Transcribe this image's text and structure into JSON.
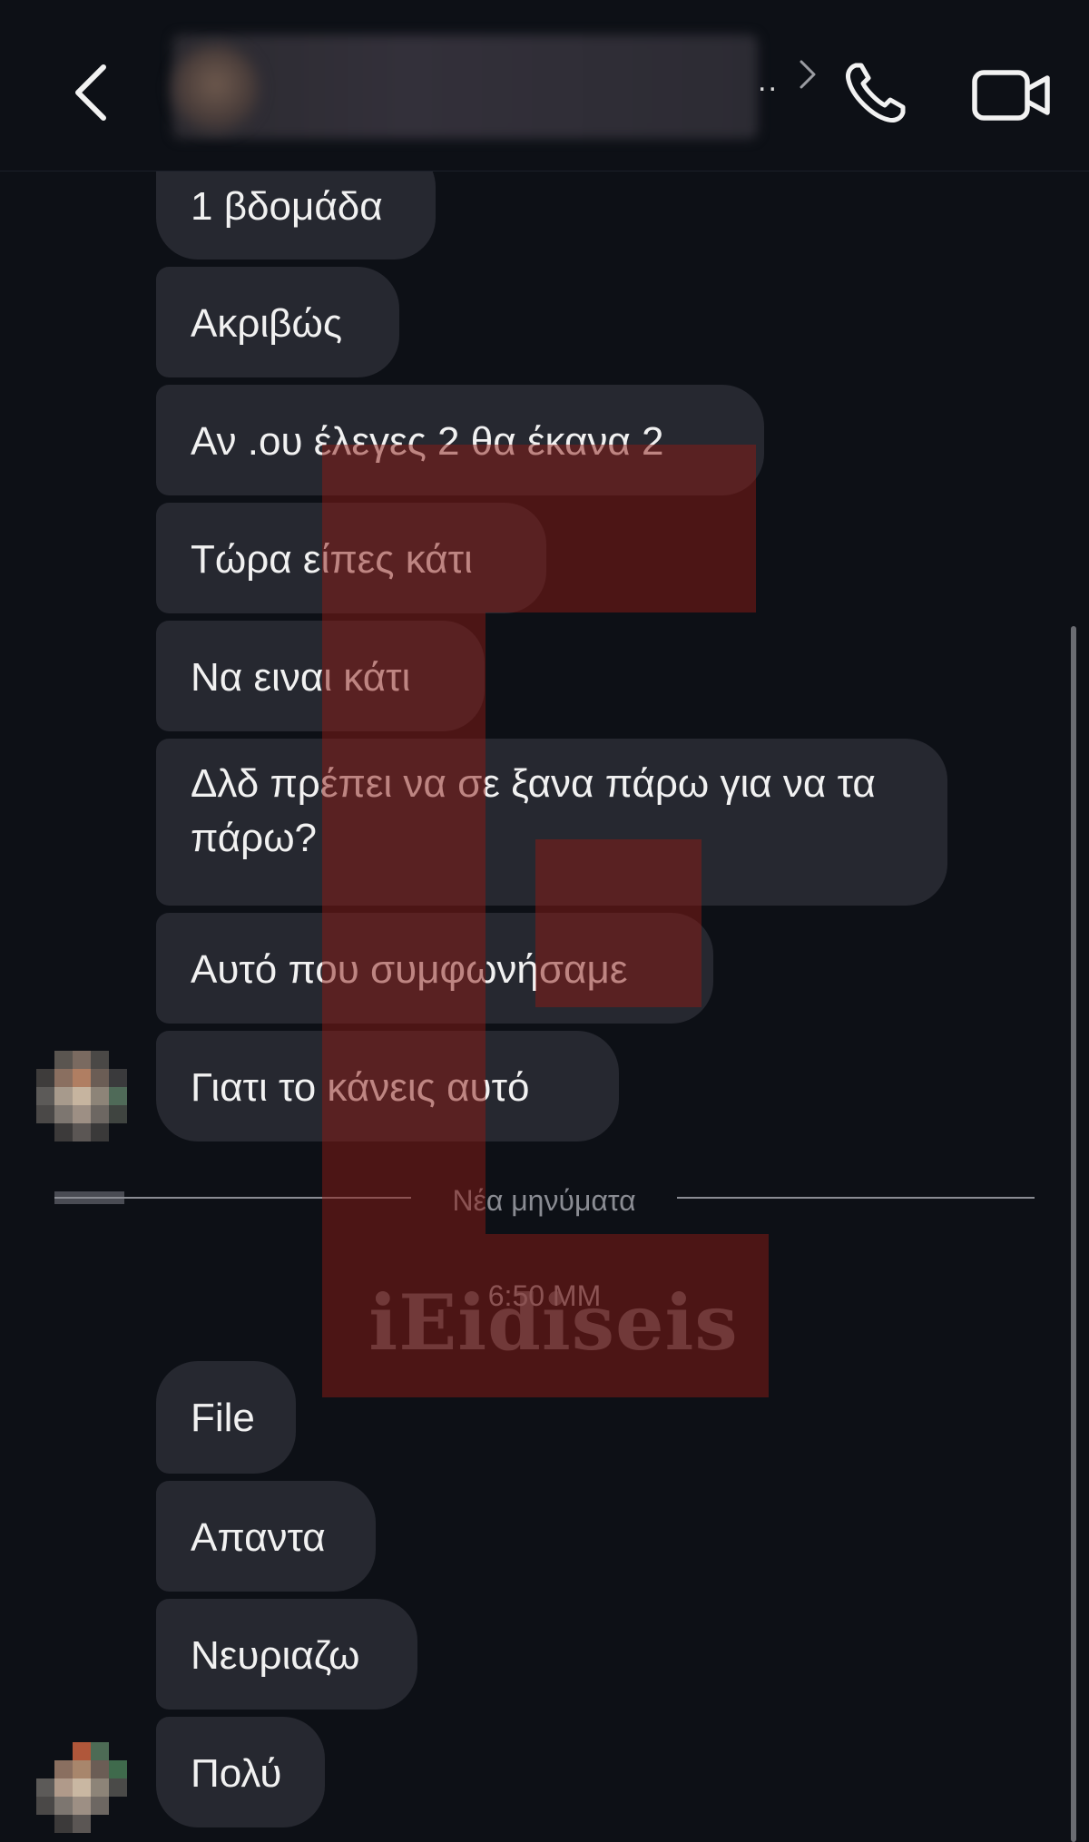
{
  "header": {
    "back_icon": "chevron-left-icon",
    "contact_name_visible_suffix": "..",
    "call_icon": "phone-icon",
    "video_icon": "video-camera-icon"
  },
  "messages_before": [
    {
      "text": "1 βδομάδα"
    },
    {
      "text": "Ακριβώς"
    },
    {
      "text": "Αν .ου έλεγες 2 θα έκανα 2"
    },
    {
      "text": "Τώρα είπες κάτι"
    },
    {
      "text": "Να ειναι κάτι"
    },
    {
      "text": "Δλδ πρέπει να σε ξανα πάρω για να τα πάρω?"
    },
    {
      "text": "Αυτό που συμφωνήσαμε"
    },
    {
      "text": "Γιατι το κάνεις αυτό"
    }
  ],
  "divider": {
    "label": "Νέα μηνύματα"
  },
  "timestamp": "6:50 ΜΜ",
  "messages_after": [
    {
      "text": "File"
    },
    {
      "text": "Απαντα"
    },
    {
      "text": "Νευριαζω"
    },
    {
      "text": "Πολύ"
    }
  ],
  "watermark": {
    "text": "iEidiseis",
    "color": "#8b1a14"
  },
  "colors": {
    "background": "#0d1016",
    "bubble": "#262830",
    "text": "#f1f1f1",
    "muted": "#8a8c93"
  }
}
